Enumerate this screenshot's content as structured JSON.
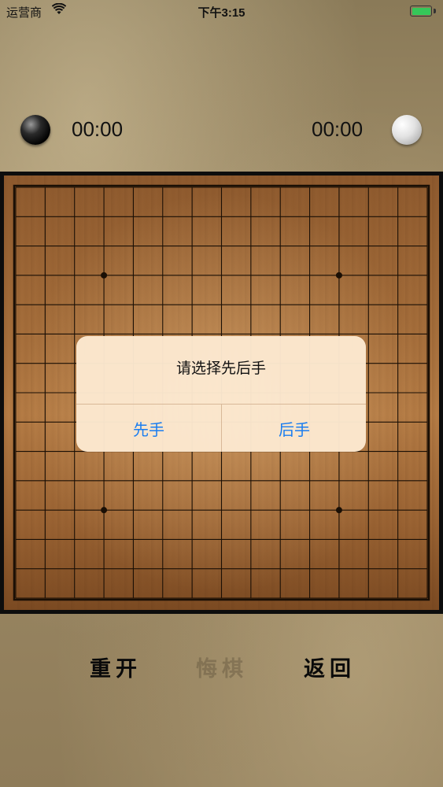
{
  "status_bar": {
    "carrier": "运营商",
    "time": "下午3:15",
    "wifi_icon": "wifi-icon",
    "battery_icon": "battery-icon",
    "battery_color": "#35c759"
  },
  "players": {
    "black": {
      "stone": "black-stone-icon",
      "timer": "00:00"
    },
    "white": {
      "stone": "white-stone-icon",
      "timer": "00:00"
    }
  },
  "board": {
    "lines": 15,
    "star_points": [
      [
        3,
        3
      ],
      [
        11,
        3
      ],
      [
        3,
        11
      ],
      [
        11,
        11
      ]
    ],
    "line_color": "#1a0f05"
  },
  "alert": {
    "title": "请选择先后手",
    "first_label": "先手",
    "second_label": "后手",
    "button_color": "#1a7df0"
  },
  "controls": {
    "restart_label": "重开",
    "undo_label": "悔棋",
    "back_label": "返回"
  }
}
